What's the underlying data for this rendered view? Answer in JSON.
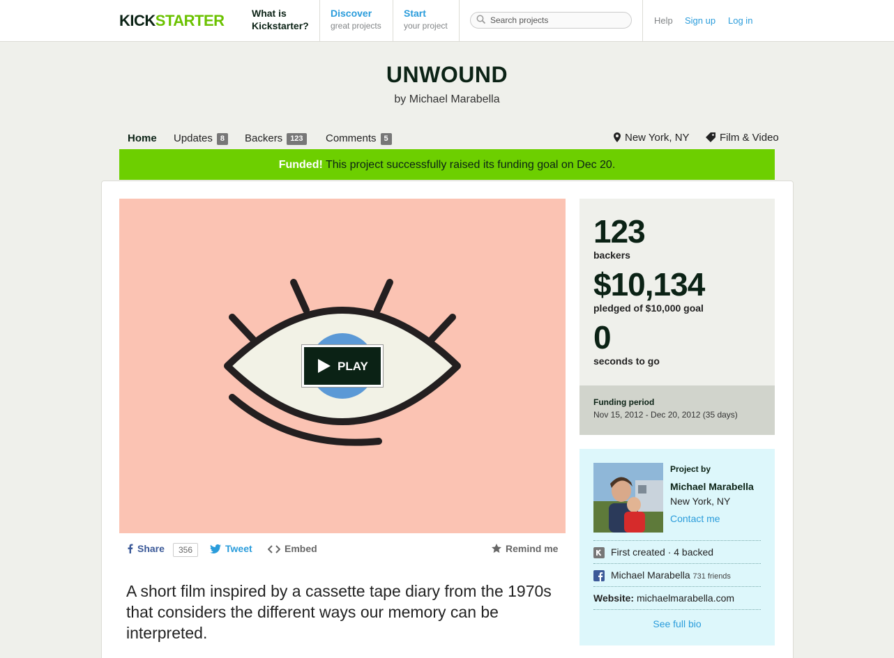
{
  "header": {
    "logo_kick": "KICK",
    "logo_starter": "STARTER",
    "nav": [
      {
        "main": "What is",
        "sub": "Kickstarter?"
      },
      {
        "main": "Discover",
        "sub": "great projects"
      },
      {
        "main": "Start",
        "sub": "your project"
      }
    ],
    "search_placeholder": "Search projects",
    "help": "Help",
    "signup": "Sign up",
    "login": "Log in"
  },
  "project": {
    "title": "UNWOUND",
    "byline": "by Michael Marabella",
    "tabs": [
      {
        "label": "Home"
      },
      {
        "label": "Updates",
        "count": "8"
      },
      {
        "label": "Backers",
        "count": "123"
      },
      {
        "label": "Comments",
        "count": "5"
      }
    ],
    "location": "New York, NY",
    "category": "Film & Video",
    "funded_strong": "Funded!",
    "funded_text": "This project successfully raised its funding goal on Dec 20.",
    "play_label": "PLAY",
    "share": {
      "share": "Share",
      "share_count": "356",
      "tweet": "Tweet",
      "embed": "Embed",
      "remind": "Remind me"
    },
    "blurb": "A short film inspired by a cassette tape diary from the 1970s that considers the different ways our memory can be interpreted."
  },
  "stats": {
    "backers_num": "123",
    "backers_label": "backers",
    "pledged_num": "$10,134",
    "pledged_label": "pledged of $10,000 goal",
    "seconds_num": "0",
    "seconds_label": "seconds to go",
    "funding_period_label": "Funding period",
    "funding_period_dates": "Nov 15, 2012 - Dec 20, 2012 (35 days)"
  },
  "creator": {
    "project_by": "Project by",
    "name": "Michael Marabella",
    "location": "New York, NY",
    "contact": "Contact me",
    "history": "First created · 4 backed",
    "fb_name": "Michael Marabella",
    "fb_friends": "731 friends",
    "website_label": "Website:",
    "website": "michaelmarabella.com",
    "full_bio": "See full bio"
  },
  "colors": {
    "brand_dark": "#0b2215",
    "brand_green": "#6bc200",
    "funded_banner": "#6dcf00",
    "link_blue": "#2a9cdb",
    "video_bg": "#fbc3b3",
    "creator_bg": "#ddf7fb"
  }
}
